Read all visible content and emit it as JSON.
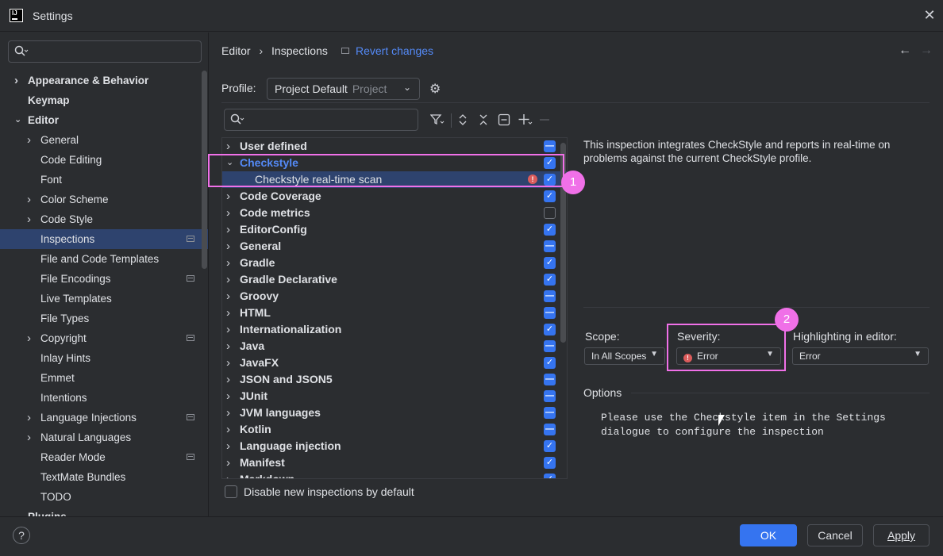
{
  "window": {
    "title": "Settings"
  },
  "sidebar": {
    "items": [
      {
        "label": "Appearance & Behavior",
        "indent": 0,
        "top": true,
        "expand": "collapsed"
      },
      {
        "label": "Keymap",
        "indent": 0,
        "top": true,
        "expand": "none"
      },
      {
        "label": "Editor",
        "indent": 0,
        "top": true,
        "expand": "expanded"
      },
      {
        "label": "General",
        "indent": 1,
        "expand": "collapsed"
      },
      {
        "label": "Code Editing",
        "indent": 1,
        "expand": "none"
      },
      {
        "label": "Font",
        "indent": 1,
        "expand": "none"
      },
      {
        "label": "Color Scheme",
        "indent": 1,
        "expand": "collapsed"
      },
      {
        "label": "Code Style",
        "indent": 1,
        "expand": "collapsed"
      },
      {
        "label": "Inspections",
        "indent": 1,
        "expand": "none",
        "selected": true,
        "project": true
      },
      {
        "label": "File and Code Templates",
        "indent": 1,
        "expand": "none"
      },
      {
        "label": "File Encodings",
        "indent": 1,
        "expand": "none",
        "project": true
      },
      {
        "label": "Live Templates",
        "indent": 1,
        "expand": "none"
      },
      {
        "label": "File Types",
        "indent": 1,
        "expand": "none"
      },
      {
        "label": "Copyright",
        "indent": 1,
        "expand": "collapsed",
        "project": true
      },
      {
        "label": "Inlay Hints",
        "indent": 1,
        "expand": "none"
      },
      {
        "label": "Emmet",
        "indent": 1,
        "expand": "none"
      },
      {
        "label": "Intentions",
        "indent": 1,
        "expand": "none"
      },
      {
        "label": "Language Injections",
        "indent": 1,
        "expand": "collapsed",
        "project": true
      },
      {
        "label": "Natural Languages",
        "indent": 1,
        "expand": "collapsed"
      },
      {
        "label": "Reader Mode",
        "indent": 1,
        "expand": "none",
        "project": true
      },
      {
        "label": "TextMate Bundles",
        "indent": 1,
        "expand": "none"
      },
      {
        "label": "TODO",
        "indent": 1,
        "expand": "none"
      },
      {
        "label": "Plugins",
        "indent": 0,
        "top": true,
        "expand": "none",
        "info": true
      }
    ]
  },
  "header": {
    "breadcrumb_parent": "Editor",
    "breadcrumb_sep": "›",
    "breadcrumb_current": "Inspections",
    "revert_label": "Revert changes"
  },
  "profile": {
    "label": "Profile:",
    "value": "Project Default",
    "scope": "Project"
  },
  "inspections": {
    "rows": [
      {
        "label": "User defined",
        "type": "group",
        "expand": "collapsed",
        "check": "partial"
      },
      {
        "label": "Checkstyle",
        "type": "group",
        "expand": "expanded",
        "check": "checked",
        "accent": true
      },
      {
        "label": "Checkstyle real-time scan",
        "type": "child",
        "expand": "none",
        "check": "checked",
        "selected": true,
        "error": true
      },
      {
        "label": "Code Coverage",
        "type": "group",
        "expand": "collapsed",
        "check": "checked"
      },
      {
        "label": "Code metrics",
        "type": "group",
        "expand": "collapsed",
        "check": "unchecked"
      },
      {
        "label": "EditorConfig",
        "type": "group",
        "expand": "collapsed",
        "check": "checked"
      },
      {
        "label": "General",
        "type": "group",
        "expand": "collapsed",
        "check": "partial"
      },
      {
        "label": "Gradle",
        "type": "group",
        "expand": "collapsed",
        "check": "checked"
      },
      {
        "label": "Gradle Declarative",
        "type": "group",
        "expand": "collapsed",
        "check": "checked"
      },
      {
        "label": "Groovy",
        "type": "group",
        "expand": "collapsed",
        "check": "partial"
      },
      {
        "label": "HTML",
        "type": "group",
        "expand": "collapsed",
        "check": "partial"
      },
      {
        "label": "Internationalization",
        "type": "group",
        "expand": "collapsed",
        "check": "checked"
      },
      {
        "label": "Java",
        "type": "group",
        "expand": "collapsed",
        "check": "partial"
      },
      {
        "label": "JavaFX",
        "type": "group",
        "expand": "collapsed",
        "check": "checked"
      },
      {
        "label": "JSON and JSON5",
        "type": "group",
        "expand": "collapsed",
        "check": "partial"
      },
      {
        "label": "JUnit",
        "type": "group",
        "expand": "collapsed",
        "check": "partial"
      },
      {
        "label": "JVM languages",
        "type": "group",
        "expand": "collapsed",
        "check": "partial"
      },
      {
        "label": "Kotlin",
        "type": "group",
        "expand": "collapsed",
        "check": "partial"
      },
      {
        "label": "Language injection",
        "type": "group",
        "expand": "collapsed",
        "check": "checked"
      },
      {
        "label": "Manifest",
        "type": "group",
        "expand": "collapsed",
        "check": "checked"
      },
      {
        "label": "Markdown",
        "type": "group",
        "expand": "collapsed",
        "check": "checked"
      }
    ],
    "disable_new_label": "Disable new inspections by default"
  },
  "details": {
    "description": "This inspection integrates CheckStyle and reports in real-time on problems against the current CheckStyle profile.",
    "scope_label": "Scope:",
    "scope_value": "In All Scopes",
    "severity_label": "Severity:",
    "severity_value": "Error",
    "highlight_label": "Highlighting in editor:",
    "highlight_value": "Error",
    "options_label": "Options",
    "options_text": "Please use the Checkstyle item in the Settings\ndialogue to configure the inspection"
  },
  "annotations": {
    "badge1": "1",
    "badge2": "2"
  },
  "footer": {
    "help_label": "?",
    "ok_label": "OK",
    "cancel_label": "Cancel",
    "apply_label": "Apply"
  },
  "colors": {
    "accent": "#3574f0",
    "link": "#548af7",
    "selection": "#2e436e",
    "highlight_box": "#f070e8",
    "error": "#db5c5c"
  }
}
